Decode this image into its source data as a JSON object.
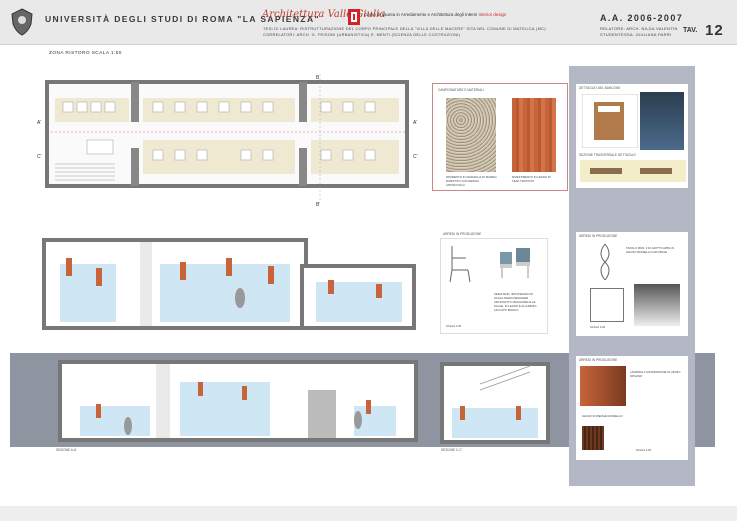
{
  "header": {
    "university": "UNIVERSITÀ DEGLI STUDI DI ROMA \"LA SAPIENZA\"",
    "signature": "Architettura Valle Giulia",
    "course_prefix": "Corso di Laurea in Arredamento e Architettura degli Interni",
    "course_highlight": "Interior design",
    "thesis_line1": "TESI DI LAUREA: RISTRUTTURAZIONE DEL CORPO PRINCIPALE DELLA \"VILLA DELLE MACERE\" SITA NEL COMUNE DI MATELICA (MC)",
    "thesis_line2": "CORRELATORI: ARCH. G. FRISONI (URBANISTICA) E. MENTI (SCIENZA DELLE COSTRUZIONI)",
    "academic_year": "A.A. 2006-2007",
    "relatore": "RELATORE: ARCH. NILDA VALENTIN",
    "studentessa": "STUDENTESSA: GIULIANA PARRI",
    "tav_label": "TAV.",
    "tav_number": "12"
  },
  "drawing": {
    "title": "ZONA RISTORO    SCALA 1:50",
    "plan_labels": {
      "a_left": "A'",
      "a_right": "A'",
      "c_left": "C'",
      "c_right": "C'",
      "b_top": "B",
      "b_bottom": "B'"
    },
    "materials_caption": "CAMPIONATURE E MATERIALI",
    "material1_caption": "PAVIMENTO IN GRANIGLIA DI MARMO RIVESTITO CON RESINA ANTISCIVOLO",
    "material2_caption": "RIVESTIMENTO IN LEGNO DI TEAK TRATTATO",
    "chair_title": "ARREDI IN PRODUZIONE",
    "chair_caption": "SEDIA MOD. 300 DISEGNO DI SCALA AVEDA DESIGNER ARCHITETTO MAGGIORE ALLE SCALE. IN LEGNO E ALLUMINIO LACCATO BIANCO",
    "chair_scale": "SCALA 1:20",
    "section_aa": "SEZIONE A-A'",
    "section_cc": "SEZIONE C-C'"
  },
  "panel": {
    "detail_title": "DETTAGLIO DEL BANCONE",
    "detail2_title": "SEZIONE TRASVERSALE DETTAGLIO",
    "table_title": "ARREDI IN PRODUZIONE",
    "table_caption": "TAVOLO MOD. 2 DI GIOTTO ARTE IN LEGNO MASSELLO NATURALE",
    "table_scale": "SCALA 1:20",
    "prod_title": "ARREDI IN PRODUZIONE",
    "prod_caption": "LAMPADA A SOSPENSIONE IN VETRO OPALINO",
    "wood_caption": "LEGNO DI WENGÈ MASSELLO",
    "panel_scale": "SCALA 1:20"
  },
  "colors": {
    "header_bg": "#e9e9e9",
    "panel_bg": "#b4b8c4",
    "band_bg": "#8f94a1",
    "accent_red": "#d2232a",
    "wood": "#c8643a",
    "glass": "#cfe6f4"
  }
}
